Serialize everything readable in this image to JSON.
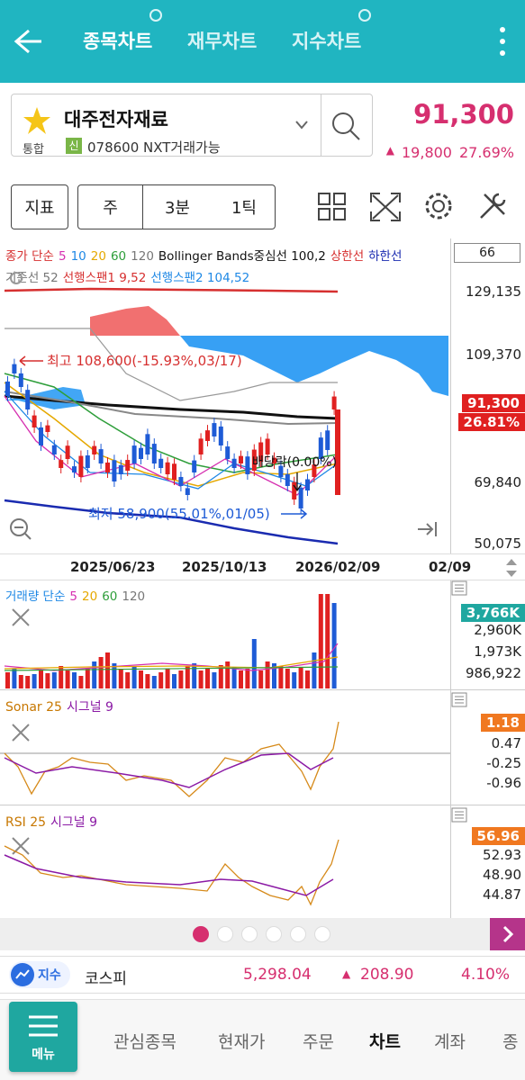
{
  "header": {
    "tabs": [
      {
        "label": "종목차트",
        "active": true,
        "has_icon": true
      },
      {
        "label": "재무차트",
        "active": false,
        "has_icon": false
      },
      {
        "label": "지수차트",
        "active": false,
        "has_icon": true
      }
    ],
    "bg_color": "#20b5c1"
  },
  "stock": {
    "name": "대주전자재료",
    "market": "통합",
    "credit_badge": "신",
    "code_text": "078600 NXT거래가능",
    "price": "91,300",
    "change": "19,800",
    "change_pct": "27.69%",
    "up_color": "#d62f6f"
  },
  "toolbar": {
    "indicator_label": "지표",
    "period_week": "주",
    "period_3min": "3분",
    "period_1tick": "1틱"
  },
  "main_chart": {
    "legend_line1": [
      {
        "text": "종가 단순",
        "color": "#d62f2f"
      },
      {
        "text": "5",
        "color": "#d62fb0"
      },
      {
        "text": "10",
        "color": "#1e88e5"
      },
      {
        "text": "20",
        "color": "#e5a800"
      },
      {
        "text": "60",
        "color": "#2e9e3a"
      },
      {
        "text": "120",
        "color": "#777777"
      },
      {
        "text": "Bollinger Bands중심선 100,2",
        "color": "#111111"
      },
      {
        "text": "상한선",
        "color": "#d62f2f"
      },
      {
        "text": "하한선",
        "color": "#1a2bb0"
      }
    ],
    "legend_line2": [
      {
        "text": "기준선 52",
        "color": "#777777"
      },
      {
        "text": "선행스팬1 9,52",
        "color": "#d62f2f"
      },
      {
        "text": "선행스팬2 104,52",
        "color": "#1e88e5"
      }
    ],
    "count_box": "66",
    "y_ticks": [
      "129,135",
      "109,370",
      "69,840",
      "50,075"
    ],
    "price_tag": "91,300",
    "pct_tag": "26.81%",
    "high_label": "최고 108,600(-15.93%,03/17)",
    "low_label": "최저 58,900(55.01%,01/05)",
    "dividend_label": "배당락(0.00%)",
    "x_labels": [
      "2025/06/23",
      "2025/10/13",
      "2026/02/09"
    ],
    "x_right_label": "02/09"
  },
  "volume_chart": {
    "legend": [
      {
        "text": "거래량 단순",
        "color": "#1e88e5"
      },
      {
        "text": "5",
        "color": "#d62fb0"
      },
      {
        "text": "20",
        "color": "#e5a800"
      },
      {
        "text": "60",
        "color": "#2e9e3a"
      },
      {
        "text": "120",
        "color": "#777777"
      }
    ],
    "tag": "3,766K",
    "y_ticks": [
      "2,960K",
      "1,973K",
      "986,922"
    ]
  },
  "sonar_chart": {
    "legend": [
      {
        "text": "Sonar 25",
        "color": "#c77700"
      },
      {
        "text": "시그널 9",
        "color": "#8b1aa5"
      }
    ],
    "tag": "1.18",
    "y_ticks": [
      "0.47",
      "-0.25",
      "-0.96"
    ]
  },
  "rsi_chart": {
    "legend": [
      {
        "text": "RSI 25",
        "color": "#c77700"
      },
      {
        "text": "시그널 9",
        "color": "#8b1aa5"
      }
    ],
    "tag": "56.96",
    "y_ticks": [
      "52.93",
      "48.90",
      "44.87"
    ]
  },
  "index_bar": {
    "badge": "지수",
    "name": "코스피",
    "value": "5,298.04",
    "change": "208.90",
    "change_pct": "4.10%"
  },
  "bottom_nav": {
    "menu_label": "메뉴",
    "items": [
      "관심종목",
      "현재가",
      "주문",
      "차트",
      "계좌",
      "종"
    ],
    "active_index": 3
  }
}
